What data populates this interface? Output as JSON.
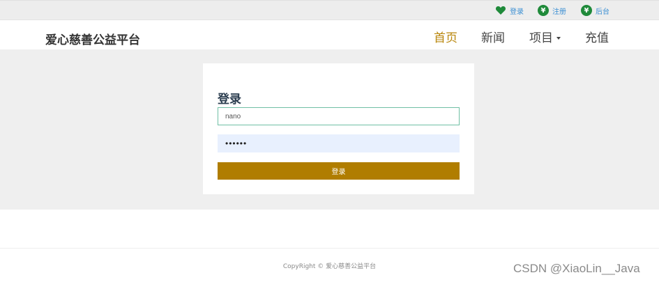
{
  "topbar": {
    "login_label": "登录",
    "register_label": "注册",
    "admin_label": "后台",
    "yen_glyph": "¥"
  },
  "navbar": {
    "brand": "爱心慈善公益平台",
    "items": [
      {
        "label": "首页"
      },
      {
        "label": "新闻"
      },
      {
        "label": "项目"
      },
      {
        "label": "充值"
      }
    ]
  },
  "login_form": {
    "title": "登录",
    "username_value": "nano",
    "password_mask": "••••••",
    "submit_label": "登录"
  },
  "footer": {
    "copyright": "CopyRight © 爱心慈善公益平台"
  },
  "watermark": "CSDN @XiaoLin__Java",
  "colors": {
    "accent_gold": "#b07d00",
    "icon_green": "#1f8a3a",
    "link_blue": "#3b8fd3"
  }
}
